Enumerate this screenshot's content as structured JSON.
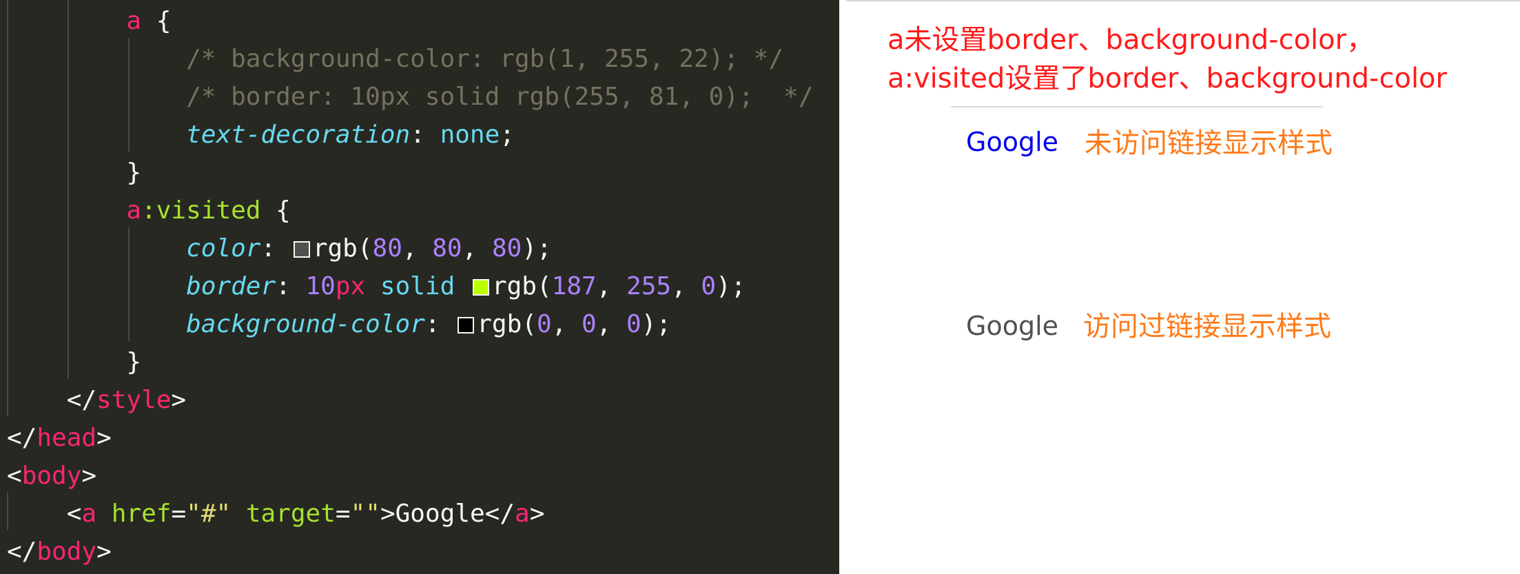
{
  "editor": {
    "lines": [
      [
        {
          "t": "        ",
          "c": "t-text"
        },
        {
          "t": "a",
          "c": "t-tag"
        },
        {
          "t": " {",
          "c": "t-punc"
        }
      ],
      [
        {
          "t": "            ",
          "c": "t-text"
        },
        {
          "t": "/* background-color: rgb(1, 255, 22); */",
          "c": "t-cmt"
        }
      ],
      [
        {
          "t": "            ",
          "c": "t-text"
        },
        {
          "t": "/* border: 10px solid rgb(255, 81, 0);  */",
          "c": "t-cmt"
        }
      ],
      [
        {
          "t": "            ",
          "c": "t-text"
        },
        {
          "t": "text-decoration",
          "c": "t-prop"
        },
        {
          "t": ": ",
          "c": "t-punc"
        },
        {
          "t": "none",
          "c": "t-kw"
        },
        {
          "t": ";",
          "c": "t-punc"
        }
      ],
      [
        {
          "t": "        }",
          "c": "t-punc"
        }
      ],
      [
        {
          "t": "        ",
          "c": "t-text"
        },
        {
          "t": "a",
          "c": "t-tag"
        },
        {
          "t": ":visited",
          "c": "t-attr"
        },
        {
          "t": " {",
          "c": "t-punc"
        }
      ],
      [
        {
          "t": "            ",
          "c": "t-text"
        },
        {
          "t": "color",
          "c": "t-prop"
        },
        {
          "t": ": ",
          "c": "t-punc"
        },
        {
          "swatch": "#505050"
        },
        {
          "t": "rgb(",
          "c": "t-text"
        },
        {
          "t": "80",
          "c": "t-num"
        },
        {
          "t": ", ",
          "c": "t-punc"
        },
        {
          "t": "80",
          "c": "t-num"
        },
        {
          "t": ", ",
          "c": "t-punc"
        },
        {
          "t": "80",
          "c": "t-num"
        },
        {
          "t": ");",
          "c": "t-punc"
        }
      ],
      [
        {
          "t": "            ",
          "c": "t-text"
        },
        {
          "t": "border",
          "c": "t-prop"
        },
        {
          "t": ": ",
          "c": "t-punc"
        },
        {
          "t": "10",
          "c": "t-num"
        },
        {
          "t": "px",
          "c": "t-unit"
        },
        {
          "t": " solid ",
          "c": "t-kw"
        },
        {
          "swatch": "#bbff00"
        },
        {
          "t": "rgb(",
          "c": "t-text"
        },
        {
          "t": "187",
          "c": "t-num"
        },
        {
          "t": ", ",
          "c": "t-punc"
        },
        {
          "t": "255",
          "c": "t-num"
        },
        {
          "t": ", ",
          "c": "t-punc"
        },
        {
          "t": "0",
          "c": "t-num"
        },
        {
          "t": ");",
          "c": "t-punc"
        }
      ],
      [
        {
          "t": "            ",
          "c": "t-text"
        },
        {
          "t": "background-color",
          "c": "t-prop"
        },
        {
          "t": ": ",
          "c": "t-punc"
        },
        {
          "swatch": "#000000"
        },
        {
          "t": "rgb(",
          "c": "t-text"
        },
        {
          "t": "0",
          "c": "t-num"
        },
        {
          "t": ", ",
          "c": "t-punc"
        },
        {
          "t": "0",
          "c": "t-num"
        },
        {
          "t": ", ",
          "c": "t-punc"
        },
        {
          "t": "0",
          "c": "t-num"
        },
        {
          "t": ");",
          "c": "t-punc"
        }
      ],
      [
        {
          "t": "        }",
          "c": "t-punc"
        }
      ],
      [
        {
          "t": "    </",
          "c": "t-punc"
        },
        {
          "t": "style",
          "c": "t-tag"
        },
        {
          "t": ">",
          "c": "t-punc"
        }
      ],
      [
        {
          "t": "</",
          "c": "t-punc"
        },
        {
          "t": "head",
          "c": "t-tag"
        },
        {
          "t": ">",
          "c": "t-punc"
        }
      ],
      [
        {
          "t": "<",
          "c": "t-punc"
        },
        {
          "t": "body",
          "c": "t-tag"
        },
        {
          "t": ">",
          "c": "t-punc"
        }
      ],
      [
        {
          "t": "    <",
          "c": "t-punc"
        },
        {
          "t": "a",
          "c": "t-tag"
        },
        {
          "t": " ",
          "c": "t-text"
        },
        {
          "t": "href",
          "c": "t-attr"
        },
        {
          "t": "=",
          "c": "t-punc"
        },
        {
          "t": "\"#\"",
          "c": "t-str"
        },
        {
          "t": " ",
          "c": "t-text"
        },
        {
          "t": "target",
          "c": "t-attr"
        },
        {
          "t": "=",
          "c": "t-punc"
        },
        {
          "t": "\"\"",
          "c": "t-str"
        },
        {
          "t": ">Google</",
          "c": "t-punc"
        },
        {
          "t": "a",
          "c": "t-tag"
        },
        {
          "t": ">",
          "c": "t-punc"
        }
      ],
      [
        {
          "t": "</",
          "c": "t-punc"
        },
        {
          "t": "body",
          "c": "t-tag"
        },
        {
          "t": ">",
          "c": "t-punc"
        }
      ]
    ]
  },
  "preview": {
    "note_line1": "a未设置border、background-color，",
    "note_line2": "a:visited设置了border、background-color",
    "link_unvisited": "Google",
    "label_unvisited": "未访问链接显示样式",
    "link_visited": "Google",
    "label_visited": "访问过链接显示样式",
    "colors": {
      "note": "#ff1a1a",
      "label": "#ff7a1a",
      "unvisited_link": "#0000ee",
      "visited_link": "#505050"
    }
  }
}
